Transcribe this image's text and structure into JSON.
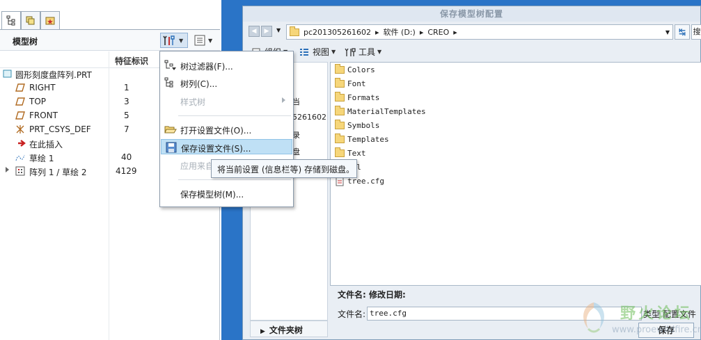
{
  "left_panel": {
    "title": "模型树",
    "column_header": "特征标识",
    "tree": [
      {
        "label": "圆形刻度盘阵列.PRT",
        "id": "",
        "icon": "part-icon"
      },
      {
        "label": "RIGHT",
        "id": "1",
        "icon": "datum-plane-icon"
      },
      {
        "label": "TOP",
        "id": "3",
        "icon": "datum-plane-icon"
      },
      {
        "label": "FRONT",
        "id": "5",
        "icon": "datum-plane-icon"
      },
      {
        "label": "PRT_CSYS_DEF",
        "id": "7",
        "icon": "coordinate-system-icon"
      },
      {
        "label": "在此插入",
        "id": "",
        "icon": "insert-here-arrow-icon"
      },
      {
        "label": "草绘 1",
        "id": "40",
        "icon": "sketch-icon"
      },
      {
        "label": "阵列 1 / 草绘 2",
        "id": "4129",
        "icon": "pattern-icon"
      }
    ]
  },
  "menu": {
    "items": [
      {
        "label": "树过滤器(F)...",
        "icon": "tree-filter-icon",
        "state": "normal"
      },
      {
        "label": "树列(C)...",
        "icon": "tree-columns-icon",
        "state": "normal"
      },
      {
        "label": "样式树",
        "icon": "",
        "state": "disabled"
      },
      {
        "label": "打开设置文件(O)...",
        "icon": "open-folder-icon",
        "state": "normal"
      },
      {
        "label": "保存设置文件(S)...",
        "icon": "save-disk-icon",
        "state": "hover"
      },
      {
        "label": "应用来自",
        "icon": "",
        "state": "disabled"
      },
      {
        "label": "保存模型树(M)...",
        "icon": "",
        "state": "normal"
      }
    ],
    "tooltip": "将当前设置 (信息栏等) 存储到磁盘。"
  },
  "dialog": {
    "title": "保存模型树配置",
    "path": [
      "pc201305261602",
      "软件 (D:)",
      "CREO"
    ],
    "search_stub": "搜",
    "commands": [
      "组织",
      "视图",
      "工具"
    ],
    "nav_items": [
      "当",
      "5261602",
      "录",
      "盘"
    ],
    "nav_footer": "文件夹树",
    "files": [
      {
        "name": "Colors",
        "type": "folder"
      },
      {
        "name": "Font",
        "type": "folder"
      },
      {
        "name": "Formats",
        "type": "folder"
      },
      {
        "name": "MaterialTemplates",
        "type": "folder"
      },
      {
        "name": "Symbols",
        "type": "folder"
      },
      {
        "name": "Templates",
        "type": "folder"
      },
      {
        "name": "Text",
        "type": "folder"
      },
      {
        "name": "..l",
        "type": "folder"
      },
      {
        "name": "tree.cfg",
        "type": "file"
      }
    ],
    "info_label": "文件名: 修改日期:",
    "filename_label": "文件名:",
    "filename_value": "tree.cfg",
    "type_label": "类型 配置文件",
    "save_label": "保存"
  },
  "watermark": {
    "text": "野火论坛",
    "url": "www.proewildfire.cn"
  }
}
